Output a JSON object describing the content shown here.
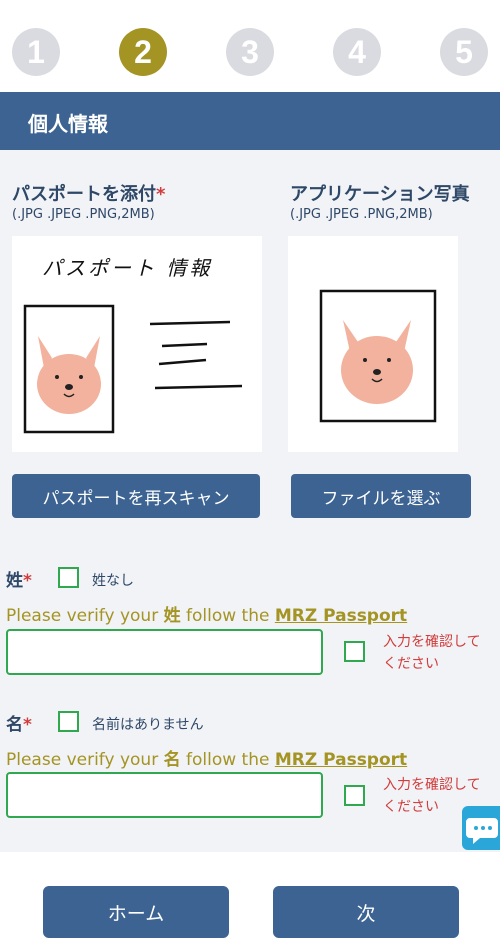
{
  "stepper": {
    "steps": [
      "1",
      "2",
      "3",
      "4",
      "5"
    ],
    "active_step": 2
  },
  "section": {
    "title": "個人情報"
  },
  "passport_upload": {
    "title": "パスポートを添付",
    "required_mark": "*",
    "hint": "(.JPG .JPEG .PNG,2MB)",
    "image_caption": "パスポート 情報",
    "button_label": "パスポートを再スキャン"
  },
  "photo_upload": {
    "title": "アプリケーション写真",
    "hint": "(.JPG .JPEG .PNG,2MB)",
    "button_label": "ファイルを選ぶ"
  },
  "surname": {
    "label": "姓",
    "required_mark": "*",
    "checkbox_label": "姓なし",
    "verify_prefix": "Please verify your ",
    "verify_field": "姓",
    "verify_mid": " follow the ",
    "verify_link": "MRZ Passport",
    "value": "",
    "confirm_text": "入力を確認してください"
  },
  "given_name": {
    "label": "名",
    "required_mark": "*",
    "checkbox_label": "名前はありません",
    "verify_prefix": "Please verify your ",
    "verify_field": "名",
    "verify_mid": " follow the ",
    "verify_link": "MRZ Passport",
    "value": "",
    "confirm_text": "入力を確認してください"
  },
  "footer": {
    "home_label": "ホーム",
    "next_label": "次"
  },
  "colors": {
    "primary": "#3c6391",
    "accent_gold": "#a49424",
    "valid_green": "#2fa84f",
    "error_red": "#d23c3c",
    "chat_blue": "#2aa7d8"
  }
}
